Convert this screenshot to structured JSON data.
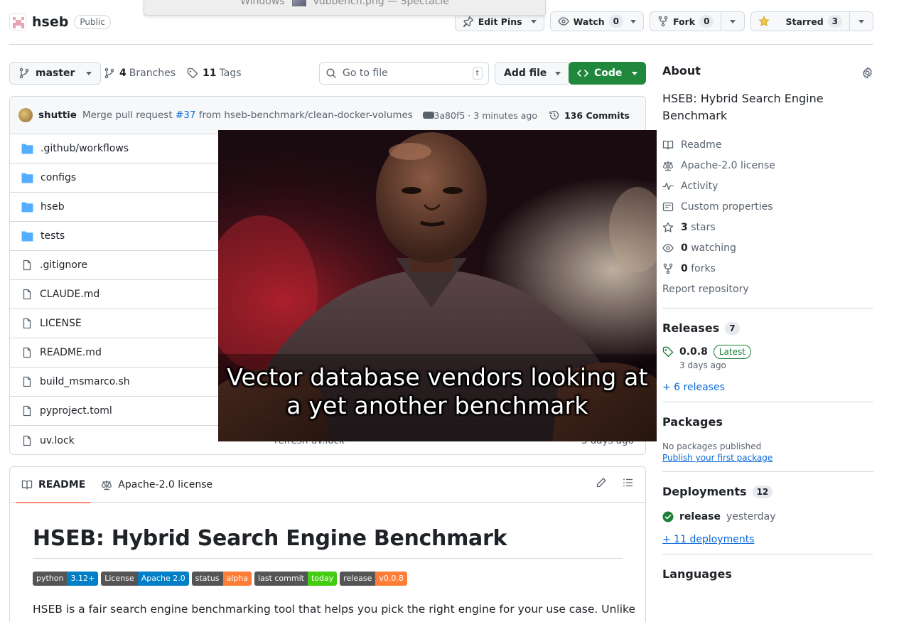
{
  "window_label": {
    "prefix": "Windows",
    "title": "vdbbench.png — Spectacle"
  },
  "repo": {
    "name": "hseb",
    "visibility": "Public"
  },
  "header_actions": {
    "edit_pins": "Edit Pins",
    "watch": "Watch",
    "watch_count": "0",
    "fork": "Fork",
    "fork_count": "0",
    "starred": "Starred",
    "star_count": "3"
  },
  "branch_bar": {
    "branch": "master",
    "branches_count": "4",
    "branches_label": "Branches",
    "tags_count": "11",
    "tags_label": "Tags",
    "goto_placeholder": "Go to file",
    "goto_key": "t",
    "add_file": "Add file",
    "code": "Code"
  },
  "commit": {
    "author": "shuttie",
    "message_pre": "Merge pull request",
    "pr": "#37",
    "message_post": "from hseb-benchmark/clean-docker-volumes",
    "hash": "83a80f5",
    "sep": "·",
    "time": "3 minutes ago",
    "commits_label": "136 Commits"
  },
  "files": [
    {
      "name": ".github/workflows",
      "type": "dir",
      "msg": "",
      "date": ""
    },
    {
      "name": "configs",
      "type": "dir",
      "msg": "",
      "date": ""
    },
    {
      "name": "hseb",
      "type": "dir",
      "msg": "",
      "date": ""
    },
    {
      "name": "tests",
      "type": "dir",
      "msg": "",
      "date": ""
    },
    {
      "name": ".gitignore",
      "type": "file",
      "msg": "",
      "date": ""
    },
    {
      "name": "CLAUDE.md",
      "type": "file",
      "msg": "",
      "date": ""
    },
    {
      "name": "LICENSE",
      "type": "file",
      "msg": "",
      "date": ""
    },
    {
      "name": "README.md",
      "type": "file",
      "msg": "",
      "date": ""
    },
    {
      "name": "build_msmarco.sh",
      "type": "file",
      "msg": "",
      "date": ""
    },
    {
      "name": "pyproject.toml",
      "type": "file",
      "msg": "",
      "date": ""
    },
    {
      "name": "uv.lock",
      "type": "file",
      "msg": "refresh uv.lock",
      "date": "3 days ago"
    }
  ],
  "meme": {
    "line1": "Vector database vendors looking at",
    "line2": "a yet another benchmark"
  },
  "readme": {
    "tab_readme": "README",
    "tab_license": "Apache-2.0 license",
    "title": "HSEB: Hybrid Search Engine Benchmark",
    "shields": [
      {
        "label": "python",
        "value": "3.12+",
        "color": "#007ec6"
      },
      {
        "label": "License",
        "value": "Apache 2.0",
        "color": "#007ec6"
      },
      {
        "label": "status",
        "value": "alpha",
        "color": "#fe7d37"
      },
      {
        "label": "last commit",
        "value": "today",
        "color": "#4c1"
      },
      {
        "label": "release",
        "value": "v0.0.8",
        "color": "#fe7d37"
      }
    ],
    "intro": "HSEB is a fair search engine benchmarking tool that helps you pick the right engine for your use case. Unlike"
  },
  "about": {
    "title": "About",
    "description": "HSEB: Hybrid Search Engine Benchmark",
    "items": {
      "readme": "Readme",
      "license": "Apache-2.0 license",
      "activity": "Activity",
      "custom": "Custom properties",
      "stars_n": "3",
      "stars": "stars",
      "watching_n": "0",
      "watching": "watching",
      "forks_n": "0",
      "forks": "forks"
    },
    "report": "Report repository"
  },
  "releases": {
    "title": "Releases",
    "count": "7",
    "version": "0.0.8",
    "latest": "Latest",
    "date": "3 days ago",
    "more": "+ 6 releases"
  },
  "packages": {
    "title": "Packages",
    "none": "No packages published",
    "publish": "Publish your first package"
  },
  "deployments": {
    "title": "Deployments",
    "count": "12",
    "env": "release",
    "when": "yesterday",
    "more": "+ 11 deployments"
  },
  "languages": {
    "title": "Languages"
  }
}
